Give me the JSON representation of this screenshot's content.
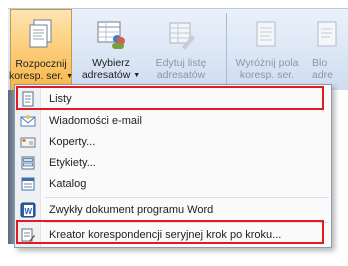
{
  "ribbon": {
    "start_merge": {
      "line1": "Rozpocznij",
      "line2": "koresp. ser."
    },
    "select_recipients": {
      "line1": "Wybierz",
      "line2": "adresatów"
    },
    "edit_list": {
      "line1": "Edytuj listę",
      "line2": "adresatów"
    },
    "highlight_fields": {
      "line1": "Wyróżnij pola",
      "line2": "koresp. ser."
    },
    "blocks_partial": {
      "line1": "Blo",
      "line2": "adre"
    }
  },
  "menu": {
    "items": [
      {
        "label": "Listy",
        "icon": "letter-icon"
      },
      {
        "label": "Wiadomości e-mail",
        "icon": "email-icon"
      },
      {
        "label": "Koperty...",
        "icon": "envelope-icon"
      },
      {
        "label": "Etykiety...",
        "icon": "labels-icon"
      },
      {
        "label": "Katalog",
        "icon": "directory-icon"
      },
      {
        "label": "Zwykły dokument programu Word",
        "icon": "word-document-icon"
      },
      {
        "label": "Kreator korespondencji seryjnej krok po kroku...",
        "icon": "wizard-icon"
      }
    ]
  },
  "colors": {
    "highlight_border": "#e01b22",
    "active_button": "#f8b548"
  }
}
